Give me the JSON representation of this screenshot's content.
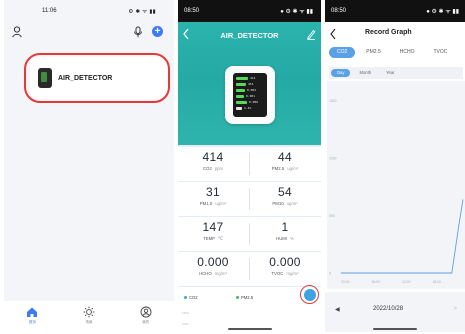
{
  "phone1": {
    "status_time": "11:06",
    "status_icons": "⚙ ✱ ᯤ ▮▮",
    "device_name": "AIR_DETECTOR",
    "nav": [
      {
        "label": "首页",
        "icon": "home-icon",
        "active": true
      },
      {
        "label": "场景",
        "icon": "sun-icon",
        "active": false
      },
      {
        "label": "我的",
        "icon": "profile-icon",
        "active": false
      }
    ]
  },
  "phone2": {
    "status_time": "08:50",
    "status_icons": "● ⚙ ✱ ᯤ ▮▮",
    "title": "AIR_DETECTOR",
    "device_display": [
      "414",
      "451",
      "0.002",
      "0.001",
      "0.000",
      "1.4%"
    ],
    "metrics": [
      {
        "left": {
          "value": "414",
          "label": "CO2",
          "unit": "ppm"
        },
        "right": {
          "value": "44",
          "label": "PM2.5",
          "unit": "ug/m³"
        }
      },
      {
        "left": {
          "value": "31",
          "label": "PM1.0",
          "unit": "ug/m³"
        },
        "right": {
          "value": "54",
          "label": "PM10",
          "unit": "ug/m³"
        }
      },
      {
        "left": {
          "value": "147",
          "label": "TEMP",
          "unit": "℃"
        },
        "right": {
          "value": "1",
          "label": "HUMI",
          "unit": "%"
        }
      },
      {
        "left": {
          "value": "0.000",
          "label": "HCHO",
          "unit": "mg/m³"
        },
        "right": {
          "value": "0.000",
          "label": "TVOC",
          "unit": "mg/m³"
        }
      }
    ],
    "legend": [
      {
        "name": "CO2",
        "color": "#3ea3e0"
      },
      {
        "name": "PM2.5",
        "color": "#41b86a"
      }
    ],
    "mini_ticks": [
      "1500",
      "1000"
    ]
  },
  "phone3": {
    "status_time": "08:50",
    "status_icons": "● ⚙ ✱ ᯤ ▮▮",
    "title": "Record Graph",
    "tabs": [
      {
        "label": "CO2",
        "active": true
      },
      {
        "label": "PM2.5",
        "active": false
      },
      {
        "label": "HCHO",
        "active": false
      },
      {
        "label": "TVOC",
        "active": false
      }
    ],
    "periods": [
      {
        "label": "Day",
        "active": true
      },
      {
        "label": "Month",
        "active": false
      },
      {
        "label": "Year",
        "active": false
      }
    ],
    "date": "2022/10/28",
    "prev_icon": "◀",
    "next_icon": ">",
    "chart_data": {
      "type": "line",
      "title": "",
      "xlabel": "",
      "ylabel": "",
      "x_ticks": [
        "00:00",
        "06:00",
        "12:00",
        "18:00"
      ],
      "y_ticks": [
        0,
        500,
        1000,
        1500
      ],
      "ylim": [
        0,
        1600
      ],
      "xlim": [
        0,
        24
      ],
      "grid": false,
      "series": [
        {
          "color": "#5aa0e6",
          "x": [
            0,
            21.8,
            23.2,
            24
          ],
          "y": [
            0,
            0,
            420,
            640
          ]
        }
      ]
    }
  }
}
